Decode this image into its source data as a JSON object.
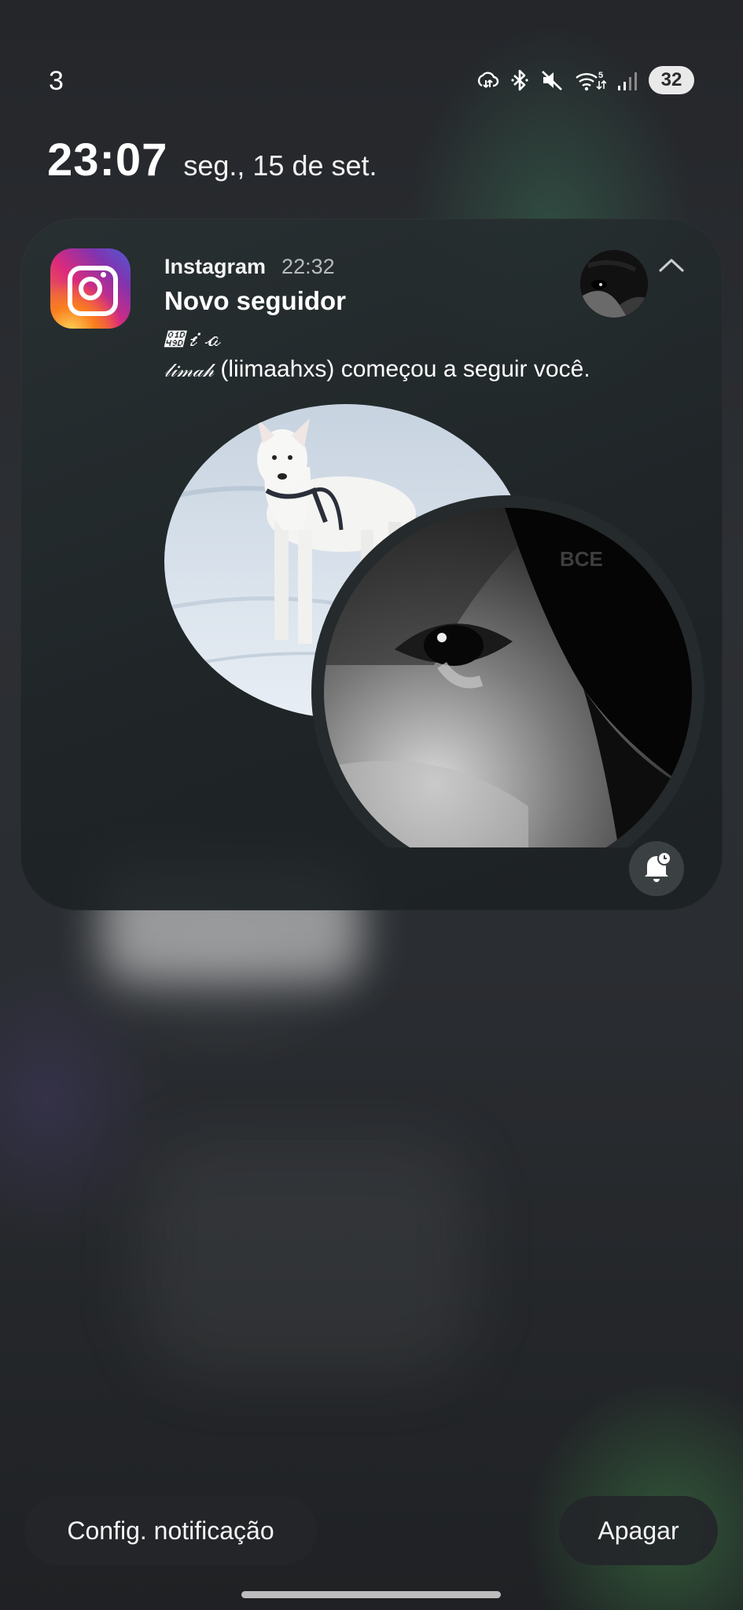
{
  "status_bar": {
    "notification_count": "3",
    "battery_level": "32",
    "icons": [
      "sync-data-icon",
      "bluetooth-icon",
      "mute-icon",
      "wifi-5g-icon",
      "signal-icon"
    ]
  },
  "lock_clock": {
    "time": "23:07",
    "date": "seg., 15 de set."
  },
  "notification": {
    "app_name": "Instagram",
    "time": "22:32",
    "title": "Novo seguidor",
    "sender_name_line1": "𝒝𝒾𝒶",
    "sender_name_line2": "𝓁𝒾𝓂𝒶𝒽",
    "body_rest": " (liimaahxs) começou a seguir você.",
    "image_watermark": "BCE",
    "app_icon": "instagram-icon",
    "colors": {
      "card_bg": "#283032",
      "accent_gradient": [
        "#f58529",
        "#dd2a7b",
        "#8134af",
        "#515bd4"
      ]
    }
  },
  "actions": {
    "settings_label": "Config. notificação",
    "clear_label": "Apagar"
  }
}
